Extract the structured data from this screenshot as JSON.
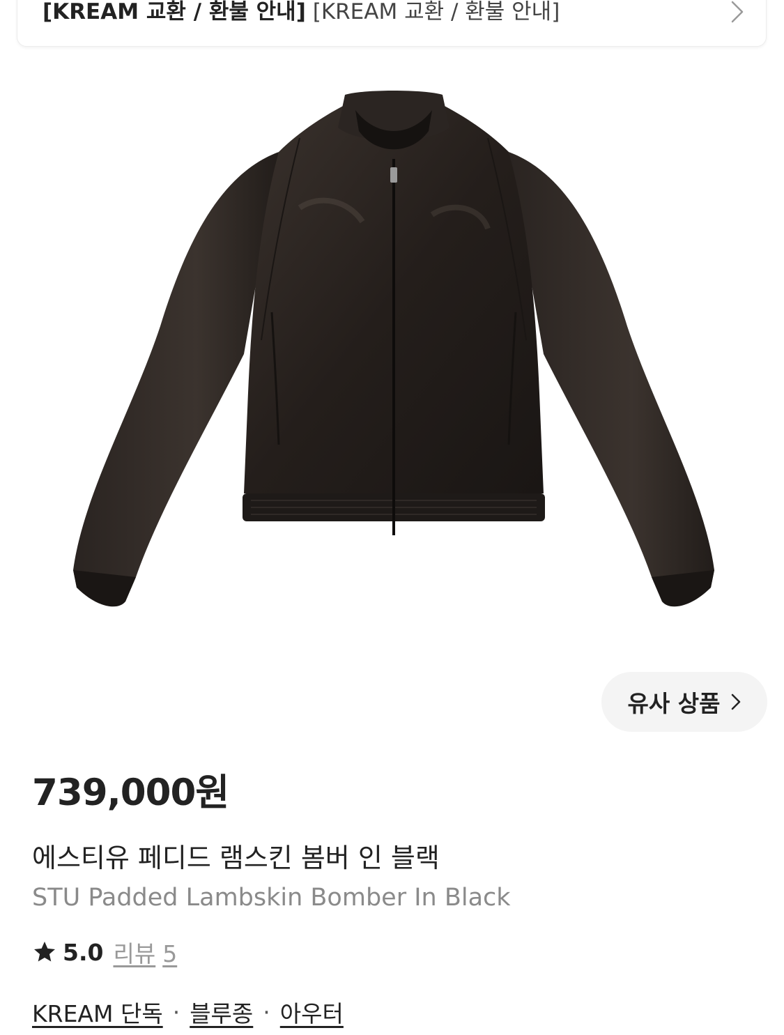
{
  "notice": {
    "bold_text": "[KREAM 교환 / 환불 안내]",
    "regular_text": "[KREAM 교환 / 환불 안내]",
    "icon": "chevron-right-icon"
  },
  "product": {
    "image_alt": "black leather bomber jacket",
    "similar_button": "유사 상품",
    "similar_icon": "chevron-right-icon",
    "price": "739,000원",
    "name_ko": "에스티유 페디드 램스킨 봄버 인 블랙",
    "name_en": "STU Padded Lambskin Bomber In Black",
    "rating": "5.0",
    "rating_icon": "star-icon",
    "review_label": "리뷰",
    "review_count": "5",
    "tags": [
      "KREAM 단독",
      "블루종",
      "아우터"
    ],
    "tag_separator": "·"
  },
  "colors": {
    "text": "#222222",
    "muted": "#8a8a8a",
    "button_bg": "#f4f4f4"
  }
}
